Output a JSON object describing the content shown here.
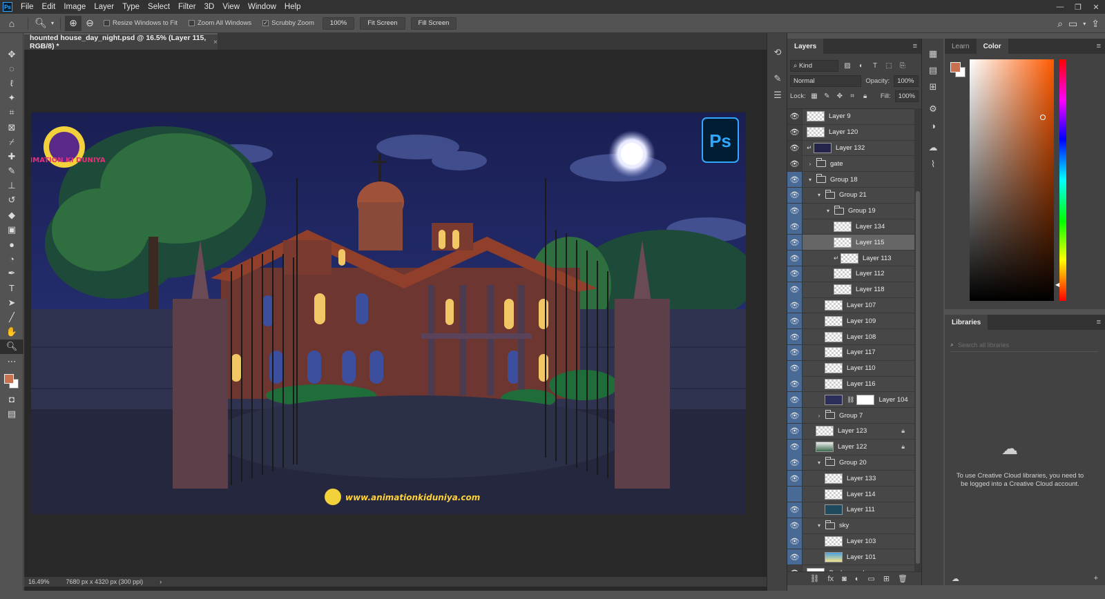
{
  "menubar": {
    "logo": "Ps",
    "items": [
      "File",
      "Edit",
      "Image",
      "Layer",
      "Type",
      "Select",
      "Filter",
      "3D",
      "View",
      "Window",
      "Help"
    ],
    "minimize": "—",
    "maximize": "❐",
    "close": "✕"
  },
  "options": {
    "resize_windows_label": "Resize Windows to Fit",
    "zoom_all_label": "Zoom All Windows",
    "scrubby_zoom_label": "Scrubby Zoom",
    "zoom_value": "100%",
    "fit_screen_label": "Fit Screen",
    "fill_screen_label": "Fill Screen"
  },
  "document": {
    "tab_title": "hounted house_day_night.psd @ 16.5% (Layer 115, RGB/8) *",
    "tab_close": "×",
    "watermark_url": "www.animationkiduniya.com",
    "logo_text": "ANIMATION KI DUNIYA",
    "ps_badge": "Ps"
  },
  "status": {
    "zoom": "16.49%",
    "dimensions": "7680 px x 4320 px (300 ppi)",
    "arrow": "›"
  },
  "layers_panel": {
    "tab_label": "Layers",
    "filter_kind": "Kind",
    "blend_mode": "Normal",
    "opacity_label": "Opacity:",
    "opacity_value": "100%",
    "lock_label": "Lock:",
    "fill_label": "Fill:",
    "fill_value": "100%",
    "layers": [
      {
        "name": "Layer 9",
        "type": "layer",
        "indent": 0,
        "thumb": "checker"
      },
      {
        "name": "Layer 120",
        "type": "layer",
        "indent": 0,
        "thumb": "checker"
      },
      {
        "name": "Layer 132",
        "type": "layer",
        "indent": 0,
        "thumb": "dark",
        "clip": true
      },
      {
        "name": "gate",
        "type": "group",
        "indent": 0,
        "open": false,
        "hidden_eye_hl": false
      },
      {
        "name": "Group 18",
        "type": "group",
        "indent": 0,
        "open": true,
        "hl": true
      },
      {
        "name": "Group 21",
        "type": "group",
        "indent": 1,
        "open": true,
        "hl": true
      },
      {
        "name": "Group 19",
        "type": "group",
        "indent": 2,
        "open": true,
        "hl": true
      },
      {
        "name": "Layer 134",
        "type": "layer",
        "indent": 3,
        "thumb": "checker",
        "hl": true
      },
      {
        "name": "Layer 115",
        "type": "layer",
        "indent": 3,
        "thumb": "checker",
        "hl": true,
        "active": true
      },
      {
        "name": "Layer 113",
        "type": "layer",
        "indent": 3,
        "thumb": "checker",
        "hl": true,
        "clip": true
      },
      {
        "name": "Layer 112",
        "type": "layer",
        "indent": 3,
        "thumb": "checker",
        "hl": true
      },
      {
        "name": "Layer 118",
        "type": "layer",
        "indent": 3,
        "thumb": "checker",
        "hl": true
      },
      {
        "name": "Layer 107",
        "type": "layer",
        "indent": 2,
        "thumb": "checker",
        "hl": true
      },
      {
        "name": "Layer 109",
        "type": "layer",
        "indent": 2,
        "thumb": "checker",
        "hl": true
      },
      {
        "name": "Layer 108",
        "type": "layer",
        "indent": 2,
        "thumb": "checker",
        "hl": true
      },
      {
        "name": "Layer 117",
        "type": "layer",
        "indent": 2,
        "thumb": "checker",
        "hl": true
      },
      {
        "name": "Layer 110",
        "type": "layer",
        "indent": 2,
        "thumb": "checker",
        "hl": true
      },
      {
        "name": "Layer 116",
        "type": "layer",
        "indent": 2,
        "thumb": "checker",
        "hl": true
      },
      {
        "name": "Layer 104",
        "type": "layer",
        "indent": 2,
        "thumb": "house",
        "hl": true,
        "mask": true
      },
      {
        "name": "Group 7",
        "type": "group",
        "indent": 1,
        "open": false,
        "hl": true
      },
      {
        "name": "Layer 123",
        "type": "layer",
        "indent": 1,
        "thumb": "checker",
        "hl": true,
        "locked": true
      },
      {
        "name": "Layer 122",
        "type": "layer",
        "indent": 1,
        "thumb": "trees",
        "hl": true,
        "locked": true
      },
      {
        "name": "Group 20",
        "type": "group",
        "indent": 1,
        "open": true,
        "hl": true
      },
      {
        "name": "Layer 133",
        "type": "layer",
        "indent": 2,
        "thumb": "checker",
        "hl": true
      },
      {
        "name": "Layer 114",
        "type": "layer",
        "indent": 2,
        "thumb": "checker",
        "hl": true,
        "eye_off": true
      },
      {
        "name": "Layer 111",
        "type": "layer",
        "indent": 2,
        "thumb": "teal",
        "hl": true
      },
      {
        "name": "sky",
        "type": "group",
        "indent": 1,
        "open": true,
        "hl": true
      },
      {
        "name": "Layer 103",
        "type": "layer",
        "indent": 2,
        "thumb": "checker",
        "hl": true
      },
      {
        "name": "Layer 101",
        "type": "layer",
        "indent": 2,
        "thumb": "sky",
        "hl": true
      },
      {
        "name": "Background",
        "type": "layer",
        "indent": 0,
        "thumb": "white",
        "locked": true,
        "italic": true
      }
    ]
  },
  "right_panels": {
    "learn_tab": "Learn",
    "color_tab": "Color",
    "libraries_tab": "Libraries",
    "search_placeholder": "Search all libraries",
    "libraries_message": "To use Creative Cloud libraries, you need to be logged into a Creative Cloud account.",
    "fg_color": "#c9714e",
    "bg_color": "#ffffff"
  }
}
